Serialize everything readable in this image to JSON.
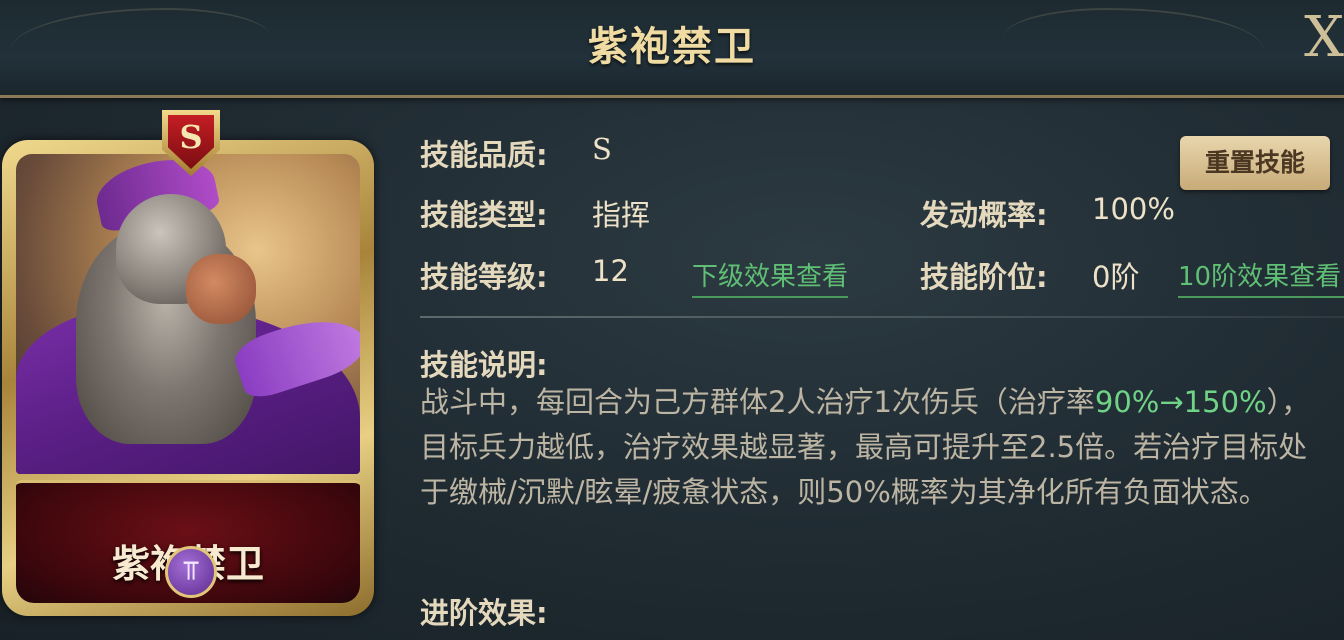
{
  "header": {
    "title": "紫袍禁卫",
    "close_label": "X"
  },
  "card": {
    "rank": "S",
    "name": "紫袍禁卫",
    "faction_icon": "faction-emblem-icon"
  },
  "info": {
    "quality_label": "技能品质:",
    "quality_value": "S",
    "type_label": "技能类型:",
    "type_value": "指挥",
    "level_label": "技能等级:",
    "level_value": "12",
    "next_level_link": "下级效果查看",
    "trigger_label": "发动概率:",
    "trigger_value": "100%",
    "stage_label": "技能阶位:",
    "stage_value": "0阶",
    "stage10_link": "10阶效果查看",
    "reset_button": "重置技能",
    "desc_label": "技能说明:",
    "desc_part1": "战斗中，每回合为己方群体2人治疗1次伤兵（治疗率",
    "desc_highlight": "90%→150%",
    "desc_part2": "），目标兵力越低，治疗效果越显著，最高可提升至2.5倍。若治疗目标处于缴械/沉默/眩晕/疲惫状态，则50%概率为其净化所有负面状态。",
    "advance_label": "进阶效果:"
  },
  "colors": {
    "highlight": "#6fd486",
    "title_gold": "#f0dba2",
    "button_bg": "#d9c193"
  }
}
